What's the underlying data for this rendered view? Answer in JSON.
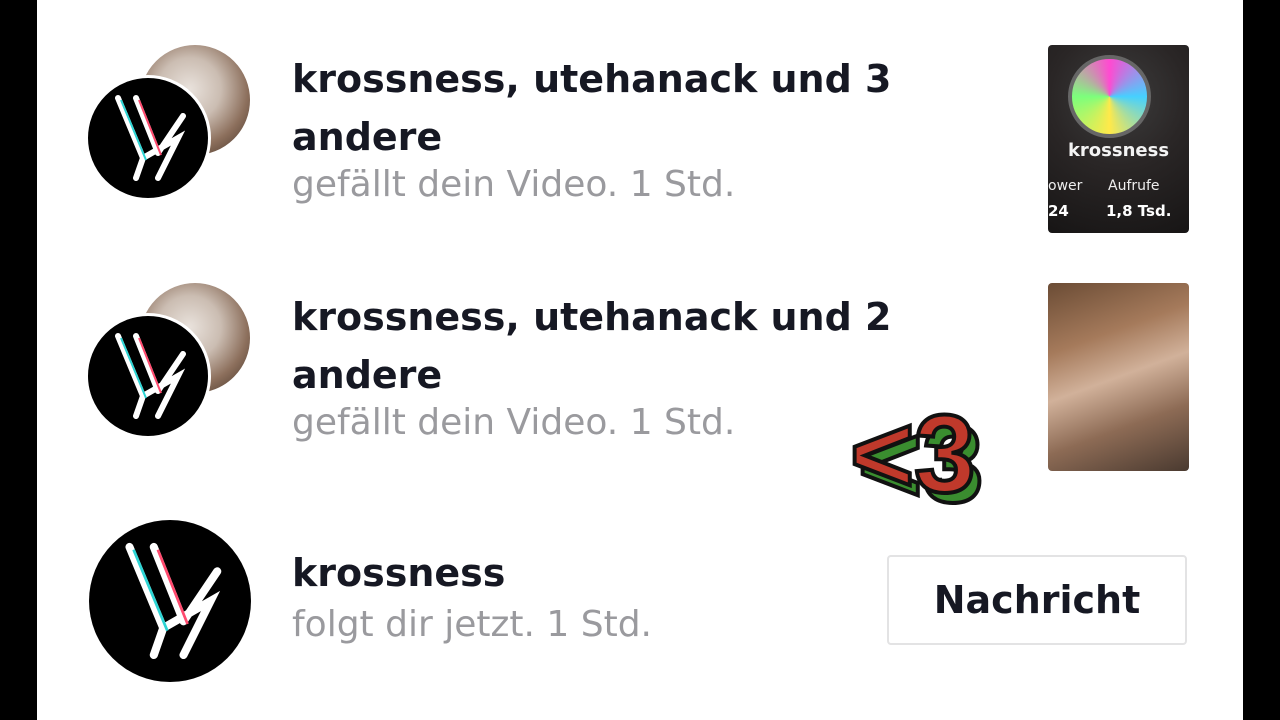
{
  "notifications": [
    {
      "title": "krossness, utehanack und 3 andere",
      "action": "gefällt dein Video.",
      "time": "1 Std.",
      "thumbnail": {
        "name": "krossness",
        "stat_left_label": "ower",
        "stat_right_label": "Aufrufe",
        "stat_left_value": "24",
        "stat_right_value": "1,8 Tsd."
      }
    },
    {
      "title": "krossness, utehanack und 2 andere",
      "action": "gefällt dein Video.",
      "time": "1 Std."
    },
    {
      "title": "krossness",
      "action": "folgt dir jetzt.",
      "time": "1 Std.",
      "button_label": "Nachricht"
    }
  ],
  "sticker": {
    "text": "<3",
    "colors": {
      "fill": "#c0392b",
      "shadow": "#3a8d2f",
      "outline": "#111111"
    }
  },
  "colors": {
    "background": "#ffffff",
    "title": "#161823",
    "secondary": "#9a9a9e",
    "frame": "#000000"
  }
}
